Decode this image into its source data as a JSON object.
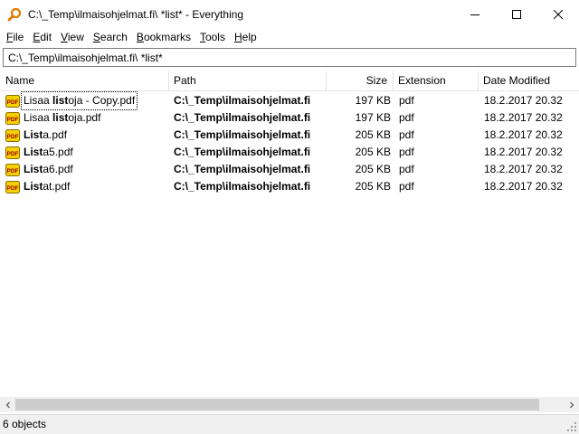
{
  "window": {
    "title": "C:\\_Temp\\ilmaisohjelmat.fi\\ *list* - Everything",
    "controls": [
      "minimize-icon",
      "maximize-icon",
      "close-icon"
    ]
  },
  "menu": [
    {
      "accel": "F",
      "rest": "ile"
    },
    {
      "accel": "E",
      "rest": "dit"
    },
    {
      "accel": "V",
      "rest": "iew"
    },
    {
      "accel": "S",
      "rest": "earch"
    },
    {
      "accel": "B",
      "rest": "ookmarks"
    },
    {
      "accel": "T",
      "rest": "ools"
    },
    {
      "accel": "H",
      "rest": "elp"
    }
  ],
  "search": {
    "value": "C:\\_Temp\\ilmaisohjelmat.fi\\ *list*"
  },
  "columns": {
    "name": "Name",
    "path": "Path",
    "size": "Size",
    "extension": "Extension",
    "date": "Date Modified"
  },
  "rows": [
    {
      "name_pre": "Lisaa ",
      "name_bold": "list",
      "name_post": "oja - Copy.pdf",
      "path": "C:\\_Temp\\ilmaisohjelmat.fi",
      "size": "197 KB",
      "ext": "pdf",
      "date": "18.2.2017 20.32"
    },
    {
      "name_pre": "Lisaa ",
      "name_bold": "list",
      "name_post": "oja.pdf",
      "path": "C:\\_Temp\\ilmaisohjelmat.fi",
      "size": "197 KB",
      "ext": "pdf",
      "date": "18.2.2017 20.32"
    },
    {
      "name_pre": "",
      "name_bold": "List",
      "name_post": "a.pdf",
      "path": "C:\\_Temp\\ilmaisohjelmat.fi",
      "size": "205 KB",
      "ext": "pdf",
      "date": "18.2.2017 20.32"
    },
    {
      "name_pre": "",
      "name_bold": "List",
      "name_post": "a5.pdf",
      "path": "C:\\_Temp\\ilmaisohjelmat.fi",
      "size": "205 KB",
      "ext": "pdf",
      "date": "18.2.2017 20.32"
    },
    {
      "name_pre": "",
      "name_bold": "List",
      "name_post": "a6.pdf",
      "path": "C:\\_Temp\\ilmaisohjelmat.fi",
      "size": "205 KB",
      "ext": "pdf",
      "date": "18.2.2017 20.32"
    },
    {
      "name_pre": "",
      "name_bold": "List",
      "name_post": "at.pdf",
      "path": "C:\\_Temp\\ilmaisohjelmat.fi",
      "size": "205 KB",
      "ext": "pdf",
      "date": "18.2.2017 20.32"
    }
  ],
  "status": {
    "text": "6 objects"
  },
  "colors": {
    "accent_icon": "#e07b00",
    "pdf_icon": "#f5d000",
    "scroll_thumb": "#cdcdcd"
  }
}
